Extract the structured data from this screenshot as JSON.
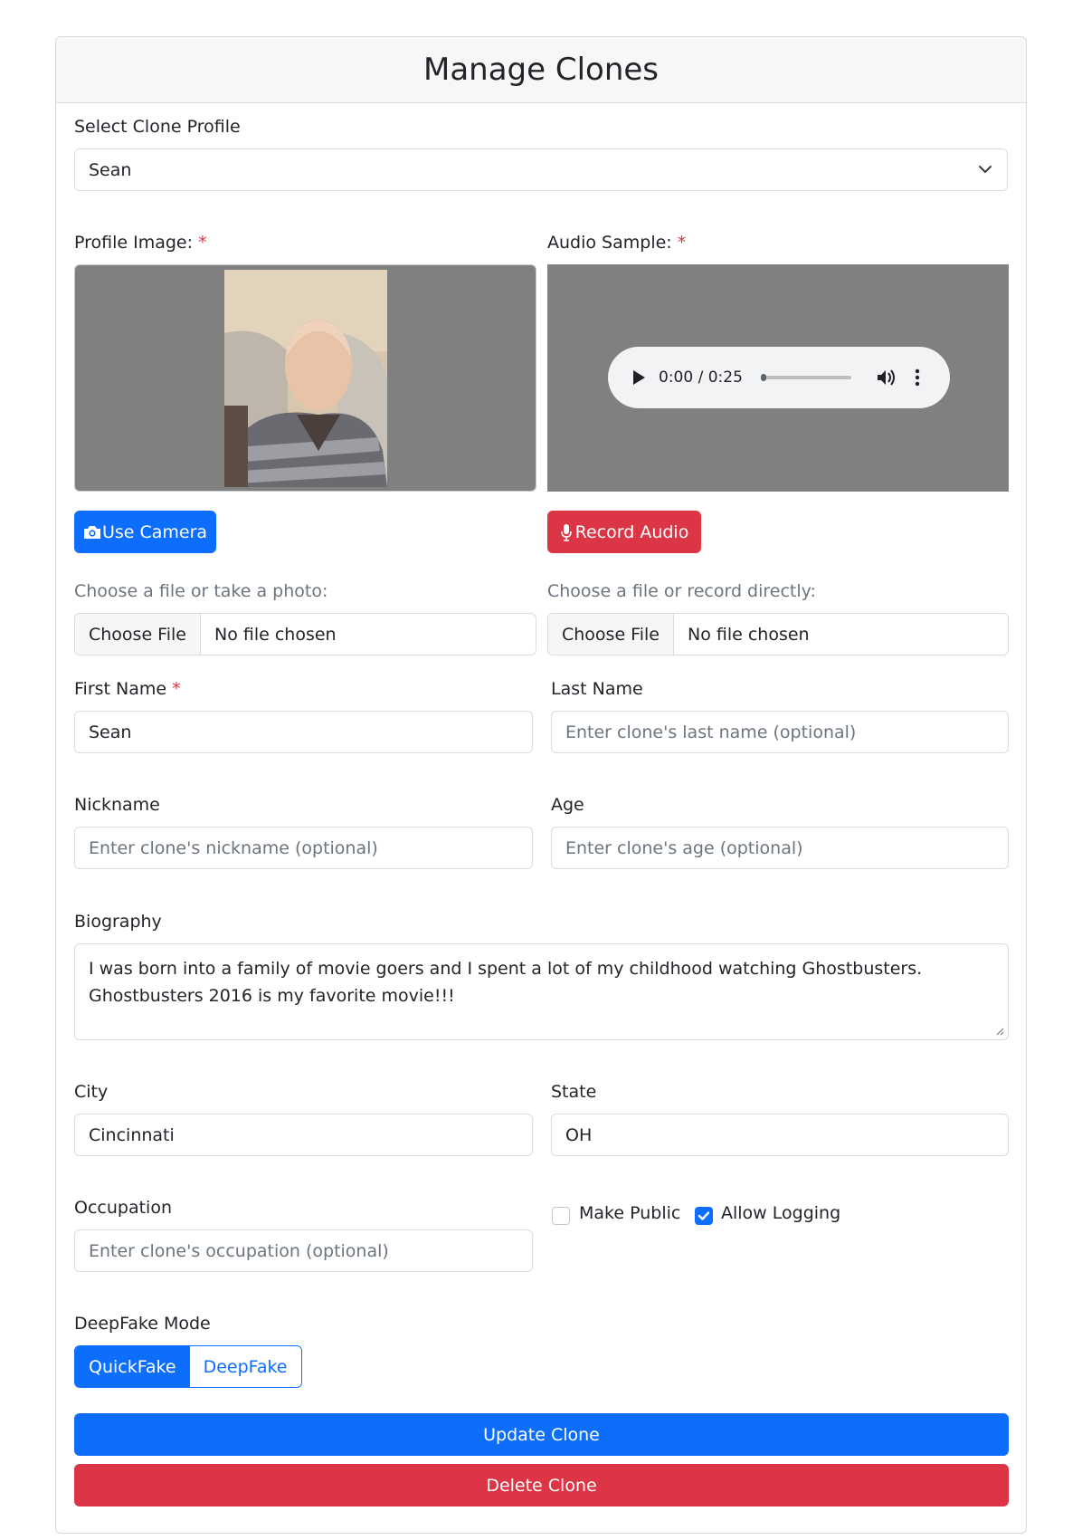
{
  "page": {
    "title": "Manage Clones"
  },
  "profile_select": {
    "label": "Select Clone Profile",
    "value": "Sean"
  },
  "profile_image": {
    "label": "Profile Image:",
    "required_mark": "*",
    "camera_button": "Use Camera",
    "file_hint": "Choose a file or take a photo:",
    "choose_file": "Choose File",
    "no_file": "No file chosen"
  },
  "audio_sample": {
    "label": "Audio Sample:",
    "required_mark": "*",
    "time": "0:00 / 0:25",
    "record_button": "Record Audio",
    "file_hint": "Choose a file or record directly:",
    "choose_file": "Choose File",
    "no_file": "No file chosen"
  },
  "form": {
    "first_name": {
      "label": "First Name",
      "required_mark": "*",
      "value": "Sean"
    },
    "last_name": {
      "label": "Last Name",
      "placeholder": "Enter clone's last name (optional)"
    },
    "nickname": {
      "label": "Nickname",
      "placeholder": "Enter clone's nickname (optional)"
    },
    "age": {
      "label": "Age",
      "placeholder": "Enter clone's age (optional)"
    },
    "biography": {
      "label": "Biography",
      "value": "I was born into a family of movie goers and I spent a lot of my childhood watching Ghostbusters. Ghostbusters 2016 is my favorite movie!!!"
    },
    "city": {
      "label": "City",
      "value": "Cincinnati"
    },
    "state": {
      "label": "State",
      "value": "OH"
    },
    "occupation": {
      "label": "Occupation",
      "placeholder": "Enter clone's occupation (optional)"
    },
    "make_public": {
      "label": "Make Public",
      "checked": false
    },
    "allow_logging": {
      "label": "Allow Logging",
      "checked": true
    },
    "deepfake_mode": {
      "label": "DeepFake Mode",
      "options": [
        "QuickFake",
        "DeepFake"
      ],
      "selected": "QuickFake"
    }
  },
  "actions": {
    "update": "Update Clone",
    "delete": "Delete Clone"
  },
  "colors": {
    "primary": "#0d6efd",
    "danger": "#dc3545",
    "media_bg": "#808080"
  }
}
